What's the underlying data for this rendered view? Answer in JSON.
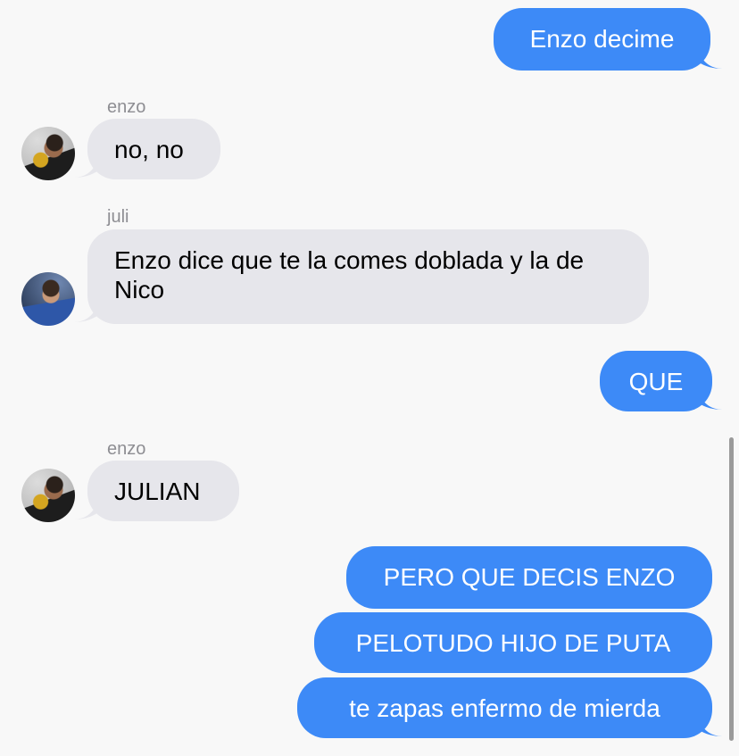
{
  "colors": {
    "background": "#f8f8f8",
    "outgoing_bubble": "#3d8af7",
    "incoming_bubble": "#e6e6eb",
    "sender_name": "#8e8e93",
    "scrollbar": "#9a9a9a"
  },
  "messages": [
    {
      "direction": "outgoing",
      "text": "Enzo decime"
    },
    {
      "direction": "incoming",
      "sender": "enzo",
      "avatar": "enzo-avatar",
      "text": "no, no"
    },
    {
      "direction": "incoming",
      "sender": "juli",
      "avatar": "juli-avatar",
      "text": "Enzo dice que te la comes doblada y la de Nico"
    },
    {
      "direction": "outgoing",
      "text": "QUE"
    },
    {
      "direction": "incoming",
      "sender": "enzo",
      "avatar": "enzo-avatar",
      "text": "JULIAN"
    },
    {
      "direction": "outgoing",
      "text": "PERO QUE DECIS ENZO"
    },
    {
      "direction": "outgoing",
      "text": "PELOTUDO HIJO DE PUTA"
    },
    {
      "direction": "outgoing",
      "text": "te zapas enfermo de mierda"
    }
  ]
}
